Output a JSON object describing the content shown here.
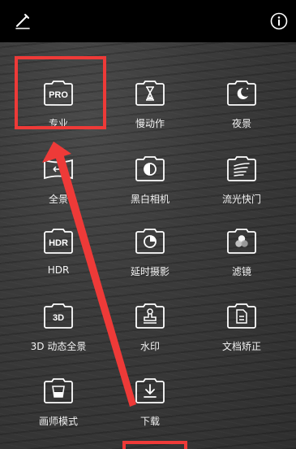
{
  "toolbar": {
    "edit_icon": "edit-pencil-icon",
    "info_icon": "info-icon"
  },
  "modes": [
    {
      "label": "专业",
      "icon": "pro-icon",
      "icon_text": "PRO"
    },
    {
      "label": "慢动作",
      "icon": "hourglass-icon"
    },
    {
      "label": "夜景",
      "icon": "moon-icon"
    },
    {
      "label": "全景",
      "icon": "panorama-icon"
    },
    {
      "label": "黑白相机",
      "icon": "bw-camera-icon"
    },
    {
      "label": "流光快门",
      "icon": "light-trail-icon"
    },
    {
      "label": "HDR",
      "icon": "hdr-icon",
      "icon_text": "HDR"
    },
    {
      "label": "延时摄影",
      "icon": "timelapse-icon"
    },
    {
      "label": "滤镜",
      "icon": "filter-icon"
    },
    {
      "label": "3D 动态全景",
      "icon": "3d-panorama-icon",
      "icon_text": "3D"
    },
    {
      "label": "水印",
      "icon": "watermark-icon"
    },
    {
      "label": "文档矫正",
      "icon": "document-correct-icon"
    },
    {
      "label": "画师模式",
      "icon": "painter-mode-icon"
    },
    {
      "label": "下载",
      "icon": "download-icon"
    }
  ],
  "annotation": {
    "color": "#ee3a38",
    "highlighted_mode": "专业"
  }
}
